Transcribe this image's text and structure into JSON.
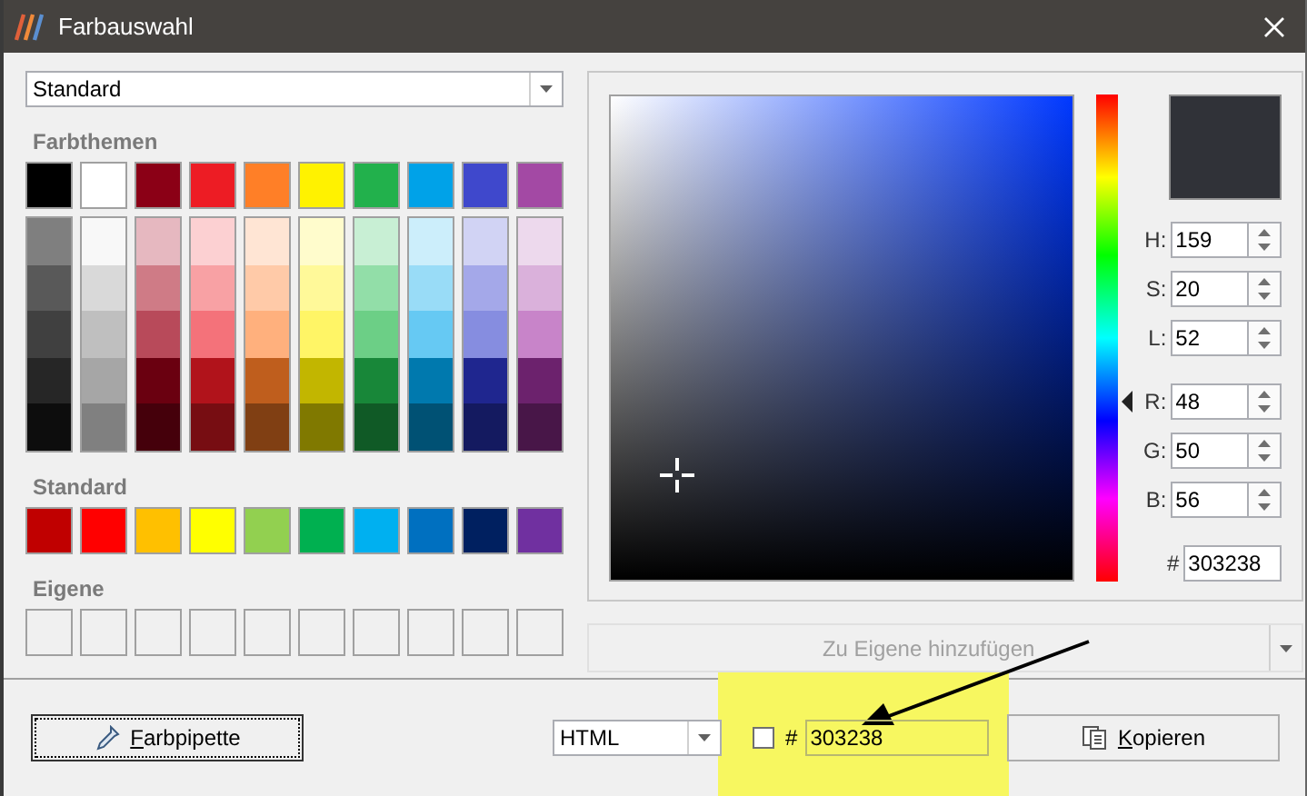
{
  "window": {
    "title": "Farbauswahl"
  },
  "palette_select": {
    "value": "Standard"
  },
  "theme_section": {
    "label": "Farbthemen",
    "columns": [
      {
        "color": "#000000",
        "shades": [
          {
            "color": "#7f7f7f"
          },
          {
            "color": "#595959"
          },
          {
            "color": "#404040"
          },
          {
            "color": "#262626"
          },
          {
            "color": "#0d0d0d"
          }
        ]
      },
      {
        "color": "#ffffff",
        "shades": [
          {
            "color": "#f8f8f8"
          },
          {
            "color": "#d9d9d9"
          },
          {
            "color": "#bfbfbf"
          },
          {
            "color": "#a6a6a6"
          },
          {
            "color": "#808080"
          }
        ]
      },
      {
        "color": "#8b0016",
        "shades": [
          {
            "color": "#e6b8c0"
          },
          {
            "color": "#cf7b86"
          },
          {
            "color": "#b84a5a"
          },
          {
            "color": "#6a0010"
          },
          {
            "color": "#45000b"
          }
        ]
      },
      {
        "color": "#ed1c24",
        "shades": [
          {
            "color": "#fcd0d2"
          },
          {
            "color": "#f8a1a4"
          },
          {
            "color": "#f4727a"
          },
          {
            "color": "#b1131b"
          },
          {
            "color": "#770d12"
          }
        ]
      },
      {
        "color": "#ff7f27",
        "shades": [
          {
            "color": "#ffe5d4"
          },
          {
            "color": "#ffcaa8"
          },
          {
            "color": "#ffb07d"
          },
          {
            "color": "#bf5e1d"
          },
          {
            "color": "#803f13"
          }
        ]
      },
      {
        "color": "#fff200",
        "shades": [
          {
            "color": "#fffccc"
          },
          {
            "color": "#fff999"
          },
          {
            "color": "#fff566"
          },
          {
            "color": "#c2b600"
          },
          {
            "color": "#807900"
          }
        ]
      },
      {
        "color": "#22b14c",
        "shades": [
          {
            "color": "#c8efd4"
          },
          {
            "color": "#92dea8"
          },
          {
            "color": "#6ccf86"
          },
          {
            "color": "#188739"
          },
          {
            "color": "#105a26"
          }
        ]
      },
      {
        "color": "#00a2e8",
        "shades": [
          {
            "color": "#cceefb"
          },
          {
            "color": "#99dcf7"
          },
          {
            "color": "#66c9f3"
          },
          {
            "color": "#0079ae"
          },
          {
            "color": "#005174"
          }
        ]
      },
      {
        "color": "#3f48cc",
        "shades": [
          {
            "color": "#d1d3f4"
          },
          {
            "color": "#a4a8e9"
          },
          {
            "color": "#868de0"
          },
          {
            "color": "#1f268f"
          },
          {
            "color": "#141a60"
          }
        ]
      },
      {
        "color": "#a349a4",
        "shades": [
          {
            "color": "#edd9ed"
          },
          {
            "color": "#dab1db"
          },
          {
            "color": "#c884c9"
          },
          {
            "color": "#6c226d"
          },
          {
            "color": "#481648"
          }
        ]
      }
    ]
  },
  "standard_section": {
    "label": "Standard",
    "swatches": [
      {
        "color": "#c00000"
      },
      {
        "color": "#ff0000"
      },
      {
        "color": "#ffc000"
      },
      {
        "color": "#ffff00"
      },
      {
        "color": "#92d050"
      },
      {
        "color": "#00b050"
      },
      {
        "color": "#00b0f0"
      },
      {
        "color": "#0070c0"
      },
      {
        "color": "#002060"
      },
      {
        "color": "#7030a0"
      }
    ]
  },
  "custom_section": {
    "label": "Eigene",
    "slots": [
      {
        "kind": "empty"
      },
      {
        "kind": "empty"
      },
      {
        "kind": "empty"
      },
      {
        "kind": "empty"
      },
      {
        "kind": "empty"
      },
      {
        "kind": "empty"
      },
      {
        "kind": "empty"
      },
      {
        "kind": "empty"
      },
      {
        "kind": "empty"
      },
      {
        "kind": "empty"
      }
    ]
  },
  "picker": {
    "hue": {
      "level": 0.37
    },
    "preview": {
      "color": "#303238"
    },
    "fields": [
      {
        "label": "H:",
        "value": "159"
      },
      {
        "label": "S:",
        "value": "20"
      },
      {
        "label": "L:",
        "value": "52"
      },
      {
        "label": "R:",
        "value": "48"
      },
      {
        "label": "G:",
        "value": "50"
      },
      {
        "label": "B:",
        "value": "56"
      }
    ],
    "hex": {
      "label": "#",
      "value": "303238"
    }
  },
  "add_button": {
    "label": "Zu Eigene hinzufügen",
    "disabled": true
  },
  "footer": {
    "pipette_button": {
      "label": "Farbpipette"
    },
    "format_select": {
      "value": "HTML"
    },
    "checkbox": {
      "checked": false
    },
    "hex_label": "#",
    "hex_value": "303238",
    "copy_button": {
      "label": "Kopieren"
    }
  }
}
